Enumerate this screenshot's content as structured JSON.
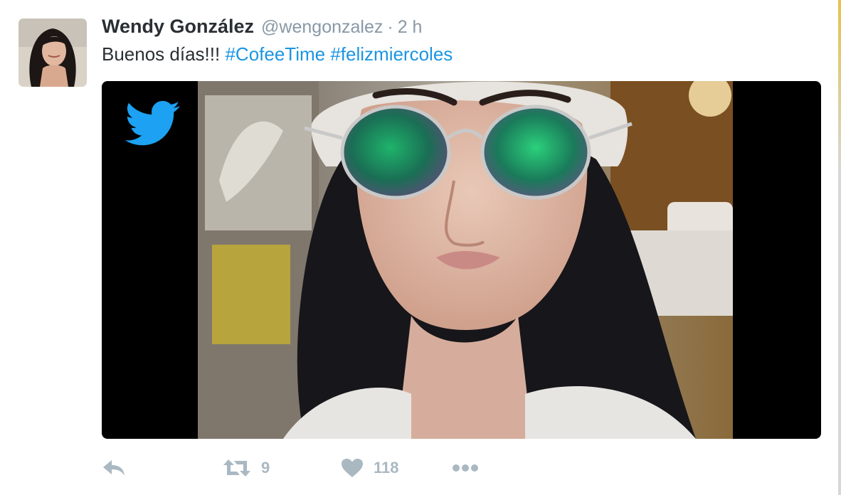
{
  "tweet": {
    "author_name": "Wendy González",
    "handle": "@wengonzalez",
    "separator": "·",
    "time": "2 h",
    "text_plain": "Buenos días!!! ",
    "hashtags": [
      "#CofeeTime",
      "#felizmiercoles"
    ],
    "media": {
      "watermark_icon": "twitter-bird-icon",
      "description_icon": "photo"
    }
  },
  "actions": {
    "reply_icon": "reply-icon",
    "retweet_icon": "retweet-icon",
    "retweet_count": "9",
    "like_icon": "heart-icon",
    "like_count": "118",
    "more_icon": "more-dots-icon"
  },
  "colors": {
    "name": "#292f33",
    "meta": "#8899a6",
    "hashtag": "#1b95e0",
    "action": "#aab8c2",
    "twitter_blue": "#1da1f2"
  }
}
